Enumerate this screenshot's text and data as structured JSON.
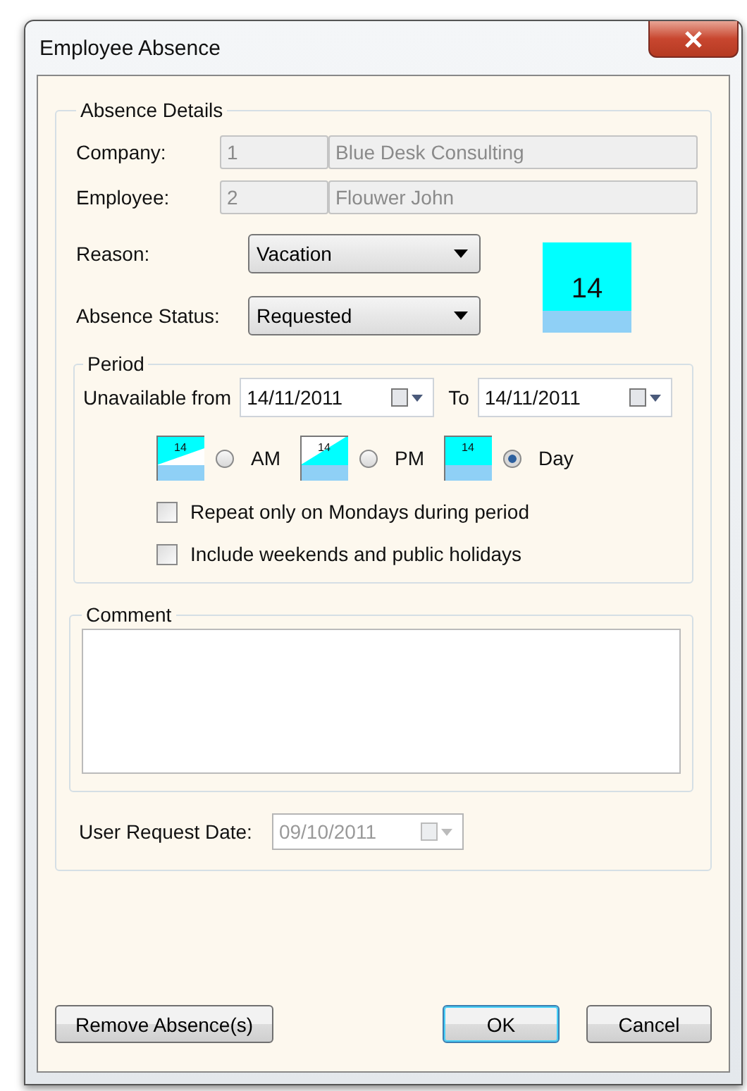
{
  "window": {
    "title": "Employee Absence"
  },
  "absence_details": {
    "title": "Absence Details",
    "company": {
      "label": "Company:",
      "code": "1",
      "name": "Blue Desk Consulting"
    },
    "employee": {
      "label": "Employee:",
      "code": "2",
      "name": "Flouwer John"
    },
    "reason": {
      "label": "Reason:",
      "value": "Vacation"
    },
    "status": {
      "label": "Absence Status:",
      "value": "Requested"
    },
    "day_badge": "14"
  },
  "period": {
    "title": "Period",
    "from_label": "Unavailable from",
    "from": "14/11/2011",
    "to_label": "To",
    "to": "14/11/2011",
    "options": [
      {
        "kind": "am",
        "day": "14",
        "label": "AM",
        "selected": false
      },
      {
        "kind": "pm",
        "day": "14",
        "label": "PM",
        "selected": false
      },
      {
        "kind": "day",
        "day": "14",
        "label": "Day",
        "selected": true
      }
    ],
    "checkboxes": [
      {
        "label": "Repeat only on Mondays during period",
        "checked": false
      },
      {
        "label": "Include weekends and public holidays",
        "checked": false
      }
    ]
  },
  "comment": {
    "title": "Comment"
  },
  "user_request_date": {
    "label": "User Request Date:",
    "value": "09/10/2011",
    "disabled": true
  },
  "buttons": {
    "remove": "Remove Absence(s)",
    "ok": "OK",
    "cancel": "Cancel"
  }
}
